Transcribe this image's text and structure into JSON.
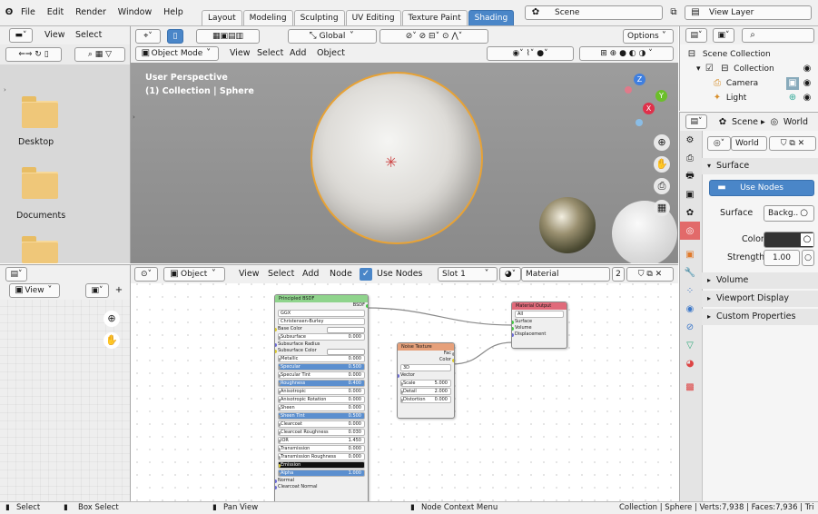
{
  "topbar": {
    "menus": [
      "File",
      "Edit",
      "Render",
      "Window",
      "Help"
    ],
    "tabs": [
      "Layout",
      "Modeling",
      "Sculpting",
      "UV Editing",
      "Texture Paint",
      "Shading"
    ],
    "active_tab": "Shading",
    "scene_label": "Scene",
    "view_layer_label": "View Layer"
  },
  "filebrowser": {
    "view_label": "View",
    "select_label": "Select",
    "folders": [
      "Desktop",
      "Documents",
      ""
    ]
  },
  "viewport": {
    "global_label": "Global",
    "options_label": "Options",
    "mode_label": "Object Mode",
    "menus": [
      "View",
      "Select",
      "Add",
      "Object"
    ],
    "perspective_label": "User Perspective",
    "collection_label": "(1) Collection | Sphere",
    "axes": {
      "x": "X",
      "y": "Y",
      "z": "Z"
    }
  },
  "outliner": {
    "scene_collection": "Scene Collection",
    "items": [
      "Collection",
      "Camera",
      "Light"
    ]
  },
  "properties": {
    "breadcrumb_scene": "Scene",
    "breadcrumb_world": "World",
    "world_name": "World",
    "surface_header": "Surface",
    "use_nodes_label": "Use Nodes",
    "surface_label": "Surface",
    "surface_value": "Backg..",
    "color_label": "Color",
    "strength_label": "Strength",
    "strength_value": "1.00",
    "sections": [
      "Volume",
      "Viewport Display",
      "Custom Properties"
    ],
    "color_hex": "#333333"
  },
  "imageeditor": {
    "view_label": "View"
  },
  "nodeeditor": {
    "object_label": "Object",
    "menus": [
      "View",
      "Select",
      "Add",
      "Node"
    ],
    "use_nodes_label": "Use Nodes",
    "slot_label": "Slot 1",
    "material_label": "Material",
    "user_count": "2"
  },
  "bsdf": {
    "title": "Principled BSDF",
    "output": "BSDF",
    "dist": "GGX",
    "subsurface_method": "Christensen-Burley",
    "rows": [
      {
        "label": "Base Color",
        "value": "",
        "kind": "color"
      },
      {
        "label": "Subsurface",
        "value": "0.000",
        "kind": "field"
      },
      {
        "label": "Subsurface Radius",
        "value": "",
        "kind": "plain"
      },
      {
        "label": "Subsurface Color",
        "value": "",
        "kind": "color"
      },
      {
        "label": "Metallic",
        "value": "0.000",
        "kind": "field"
      },
      {
        "label": "Specular",
        "value": "0.500",
        "kind": "blue"
      },
      {
        "label": "Specular Tint",
        "value": "0.000",
        "kind": "field"
      },
      {
        "label": "Roughness",
        "value": "0.400",
        "kind": "blue"
      },
      {
        "label": "Anisotropic",
        "value": "0.000",
        "kind": "field"
      },
      {
        "label": "Anisotropic Rotation",
        "value": "0.000",
        "kind": "field"
      },
      {
        "label": "Sheen",
        "value": "0.000",
        "kind": "field"
      },
      {
        "label": "Sheen Tint",
        "value": "0.500",
        "kind": "blue"
      },
      {
        "label": "Clearcoat",
        "value": "0.000",
        "kind": "field"
      },
      {
        "label": "Clearcoat Roughness",
        "value": "0.030",
        "kind": "field"
      },
      {
        "label": "IOR",
        "value": "1.450",
        "kind": "field"
      },
      {
        "label": "Transmission",
        "value": "0.000",
        "kind": "field"
      },
      {
        "label": "Transmission Roughness",
        "value": "0.000",
        "kind": "field"
      },
      {
        "label": "Emission",
        "value": "",
        "kind": "black"
      },
      {
        "label": "Alpha",
        "value": "1.000",
        "kind": "blue"
      },
      {
        "label": "Normal",
        "value": "",
        "kind": "plain"
      },
      {
        "label": "Clearcoat Normal",
        "value": "",
        "kind": "plain"
      }
    ]
  },
  "noise": {
    "title": "Noise Texture",
    "out_fac": "Fac",
    "out_color": "Color",
    "dim": "3D",
    "vector": "Vector",
    "rows": [
      {
        "label": "Scale",
        "value": "5.000"
      },
      {
        "label": "Detail",
        "value": "2.000"
      },
      {
        "label": "Distortion",
        "value": "0.000"
      }
    ]
  },
  "matout": {
    "title": "Material Output",
    "target": "All",
    "inputs": [
      "Surface",
      "Volume",
      "Displacement"
    ]
  },
  "statusbar": {
    "select": "Select",
    "box_select": "Box Select",
    "pan_view": "Pan View",
    "context_menu": "Node Context Menu",
    "stats": "Collection | Sphere | Verts:7,938 | Faces:7,936 | Tri"
  }
}
